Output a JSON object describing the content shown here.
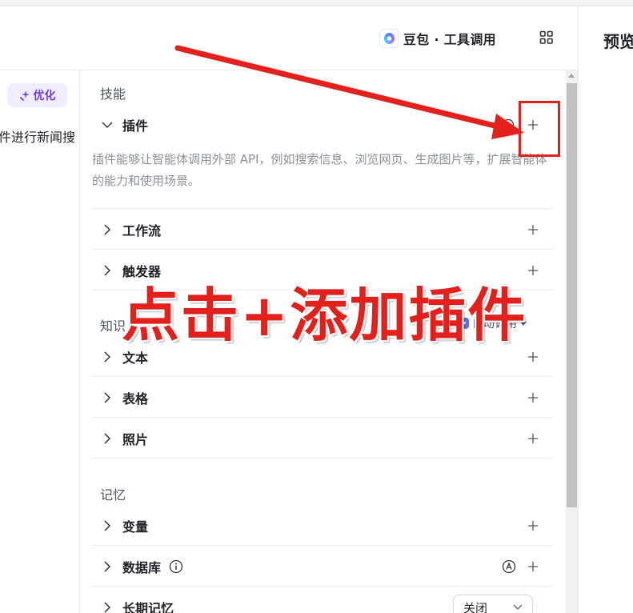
{
  "header": {
    "model_name": "豆包 · 工具调用",
    "preview_title": "预览"
  },
  "left": {
    "optimize_label": "优化",
    "prompt_fragment": "件进行新闻搜"
  },
  "skills": {
    "title": "技能",
    "plugins_label": "插件",
    "plugins_desc": "插件能够让智能体调用外部 API，例如搜索信息、浏览网页、生成图片等，扩展智能体的能力和使用场景。",
    "workflow_label": "工作流",
    "trigger_label": "触发器"
  },
  "knowledge": {
    "title": "知识",
    "auto_call_label": "自动调用",
    "text_label": "文本",
    "table_label": "表格",
    "photo_label": "照片"
  },
  "memory": {
    "title": "记忆",
    "variables_label": "变量",
    "database_label": "数据库",
    "long_term_label": "长期记忆",
    "long_term_value": "关闭"
  },
  "annotation": {
    "text": "点击+添加插件",
    "color": "#e3201b"
  },
  "icons": {
    "plus": "plus-icon",
    "chevron": "chevron-icon",
    "grid": "grid-icon"
  }
}
